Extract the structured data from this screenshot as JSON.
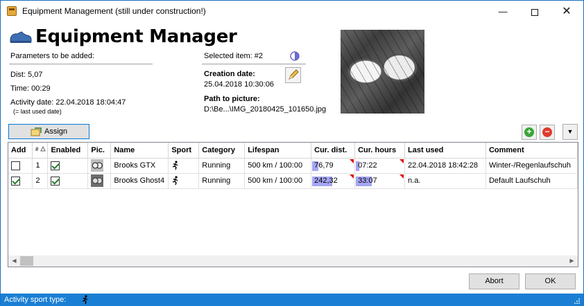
{
  "window": {
    "title": "Equipment Management (still under construction!)",
    "minimize_glyph": "—",
    "close_glyph": "✕"
  },
  "header": {
    "app_title": "Equipment Manager"
  },
  "params": {
    "heading": "Parameters to be added:",
    "dist": "Dist: 5,07",
    "time": "Time: 00:29",
    "activity_date": "Activity date: 22.04.2018 18:04:47",
    "hint": "(= last used date)"
  },
  "selected": {
    "label": "Selected item: #2",
    "creation_label": "Creation date:",
    "creation_value": "25.04.2018 10:30:06",
    "path_label": "Path to picture:",
    "path_value": "D:\\Be...\\IMG_20180425_101650.jpg"
  },
  "toolbar": {
    "assign_label": "Assign",
    "add_glyph": "+",
    "remove_glyph": "−",
    "menu_glyph": "▼"
  },
  "table": {
    "headers": [
      "Add",
      "",
      "Enabled",
      "Pic.",
      "Name",
      "Sport",
      "Category",
      "Lifespan",
      "Cur. dist.",
      "Cur. hours",
      "Last used",
      "Comment"
    ],
    "rows": [
      {
        "id": "1",
        "add": false,
        "enabled": true,
        "name": "Brooks GTX",
        "category": "Running",
        "lifespan": "500 km / 100:00",
        "dist": "76,79",
        "dist_fill": 0.15,
        "hours": "07:22",
        "hours_fill": 0.07,
        "last_used": "22.04.2018 18:42:28",
        "comment": "Winter-/Regenlaufschuh"
      },
      {
        "id": "2",
        "add": true,
        "enabled": true,
        "name": "Brooks Ghost4",
        "category": "Running",
        "lifespan": "500 km / 100:00",
        "dist": "242,32",
        "dist_fill": 0.48,
        "hours": "33:07",
        "hours_fill": 0.33,
        "last_used": "n.a.",
        "comment": "Default Laufschuh"
      }
    ]
  },
  "buttons": {
    "abort": "Abort",
    "ok": "OK"
  },
  "status": {
    "label": "Activity sport type:"
  },
  "colors": {
    "accent": "#0078d7",
    "status_bar": "#1a7fd4",
    "progress_fill": "#a6a6f5",
    "add_green": "#3aa63a",
    "remove_red": "#e03a2e"
  }
}
